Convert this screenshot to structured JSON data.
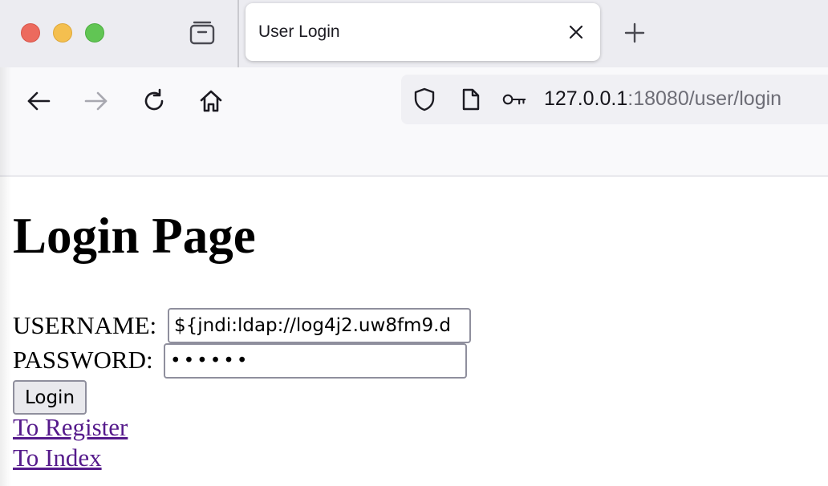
{
  "window": {
    "traffic_lights": [
      "close",
      "minimize",
      "zoom"
    ]
  },
  "tab": {
    "title": "User Login"
  },
  "toolbar": {
    "icons": [
      "back-arrow-icon",
      "forward-arrow-icon",
      "reload-icon",
      "home-icon"
    ]
  },
  "urlbar": {
    "host": "127.0.0.1",
    "rest": ":18080/user/login"
  },
  "page": {
    "title": "Login Page",
    "username_label": "USERNAME:",
    "username_value": "${jndi:ldap://log4j2.uw8fm9.d",
    "password_label": "PASSWORD:",
    "password_mask": "••••••",
    "login_button": "Login",
    "links": {
      "register": "To Register",
      "index": "To Index"
    }
  },
  "colors": {
    "link_visited": "#551a8b",
    "tab_strip": "#ececf1",
    "nav_bg": "#f9f9fb",
    "url_bg": "#f0f0f4"
  }
}
